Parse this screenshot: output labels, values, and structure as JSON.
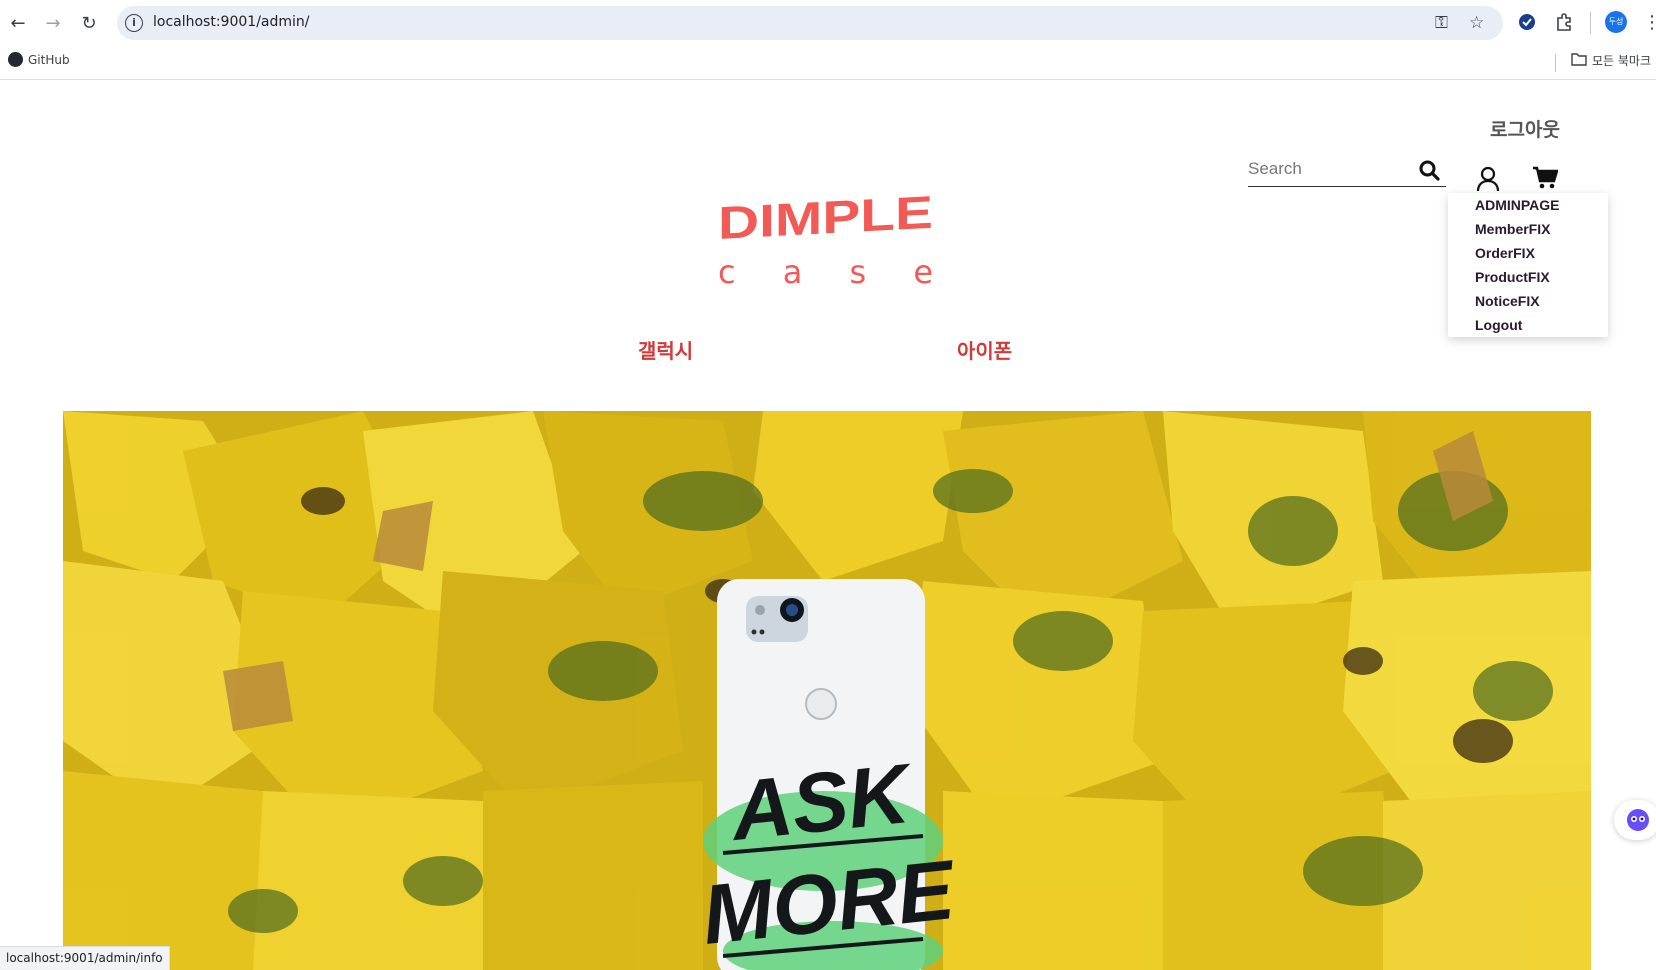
{
  "browser": {
    "url": "localhost:9001/admin/",
    "bookmarks": [
      {
        "label": "GitHub"
      }
    ],
    "all_bookmarks_label": "모든 북마크",
    "profile_initials": "두성",
    "status_url": "localhost:9001/admin/info"
  },
  "header": {
    "logout_label": "로그아웃",
    "search_placeholder": "Search",
    "logo": {
      "line1": "DIMPLE",
      "line2": "c a s e",
      "color": "#f25a55"
    }
  },
  "admin_dropdown": {
    "items": [
      "ADMINPAGE",
      "MemberFIX",
      "OrderFIX",
      "ProductFIX",
      "NoticeFIX",
      "Logout"
    ]
  },
  "category_menu": {
    "items": [
      "갤럭시",
      "아이폰"
    ],
    "color": "#d23a3a"
  },
  "hero": {
    "phone_text_line1": "ASK",
    "phone_text_line2": "MORE",
    "leaf_color": "#e6c217",
    "accent_green": "#5fd07a"
  }
}
